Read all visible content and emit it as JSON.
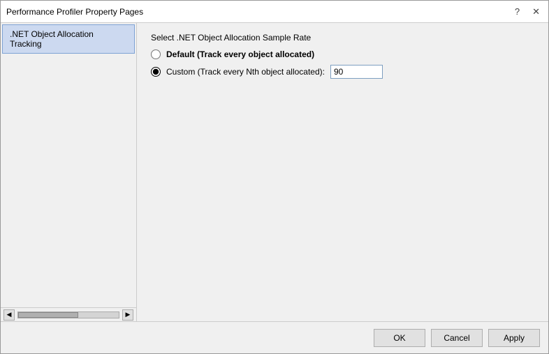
{
  "window": {
    "title": "Performance Profiler Property Pages",
    "help_btn": "?",
    "close_btn": "✕"
  },
  "sidebar": {
    "items": [
      {
        "label": ".NET Object Allocation Tracking",
        "selected": true
      }
    ],
    "scroll_left": "◀",
    "scroll_right": "▶"
  },
  "main": {
    "section_title": "Select .NET Object Allocation Sample Rate",
    "radio_default_label": "Default (Track every object allocated)",
    "radio_custom_label": "Custom (Track every Nth object allocated):",
    "custom_value": "90"
  },
  "footer": {
    "ok_label": "OK",
    "cancel_label": "Cancel",
    "apply_label": "Apply"
  }
}
